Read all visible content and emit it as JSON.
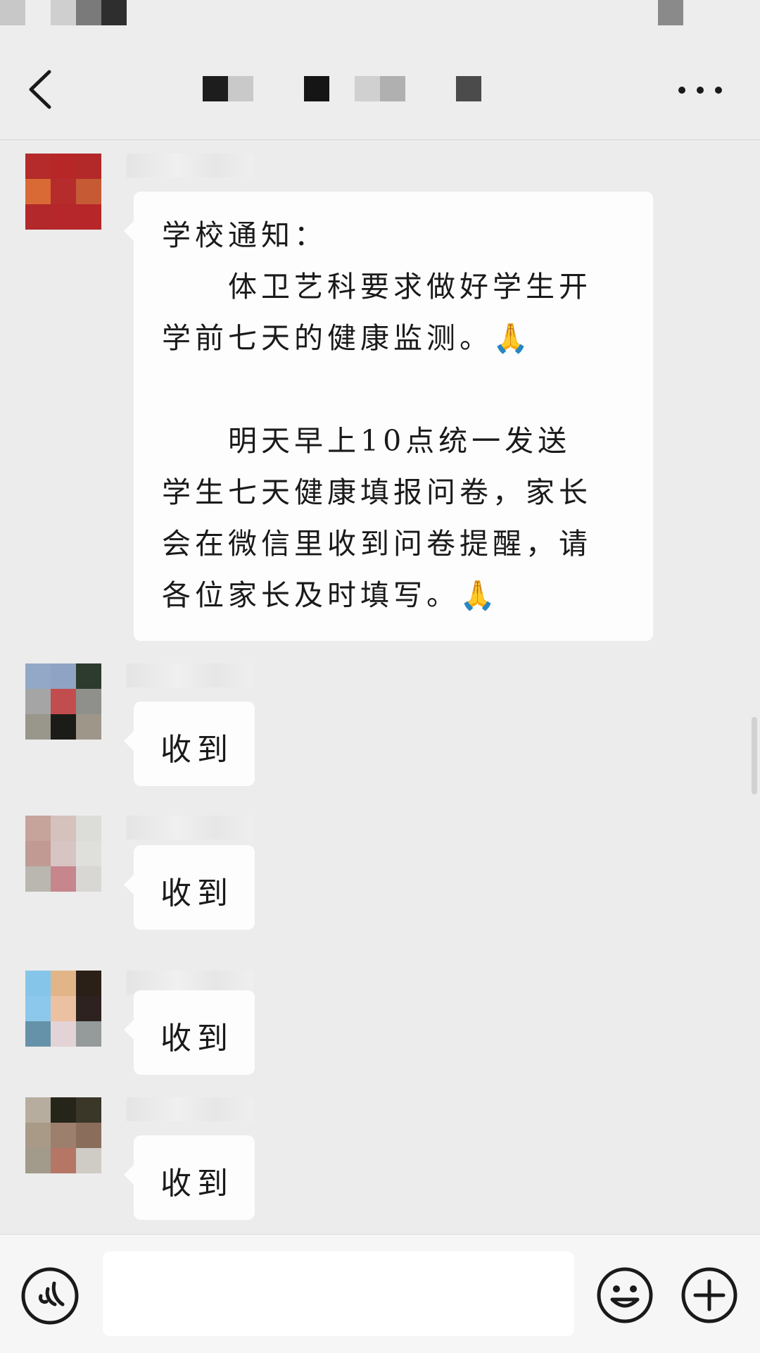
{
  "header": {
    "title_obscured": true
  },
  "messages": [
    {
      "type": "notice",
      "lines": [
        "学校通知：",
        "　　体卫艺科要求做好学生开",
        "学前七天的健康监测。",
        "",
        "　　明天早上10点统一发送",
        "学生七天健康填报问卷，家长",
        "会在微信里收到问卷提醒，请",
        "各位家长及时填写。"
      ],
      "emoji": "🙏"
    },
    {
      "type": "reply",
      "text": "收到"
    },
    {
      "type": "reply",
      "text": "收到"
    },
    {
      "type": "reply",
      "text": "收到"
    },
    {
      "type": "reply",
      "text": "收到"
    }
  ],
  "input_bar": {
    "placeholder": "",
    "icons": [
      "voice-icon",
      "emoji-face-icon",
      "plus-icon"
    ]
  },
  "icons": {
    "back": "chevron-left-icon",
    "more": "more-dots-icon"
  },
  "colors": {
    "background": "#ececec",
    "bubble": "#fdfdfd",
    "header": "#ededed"
  }
}
